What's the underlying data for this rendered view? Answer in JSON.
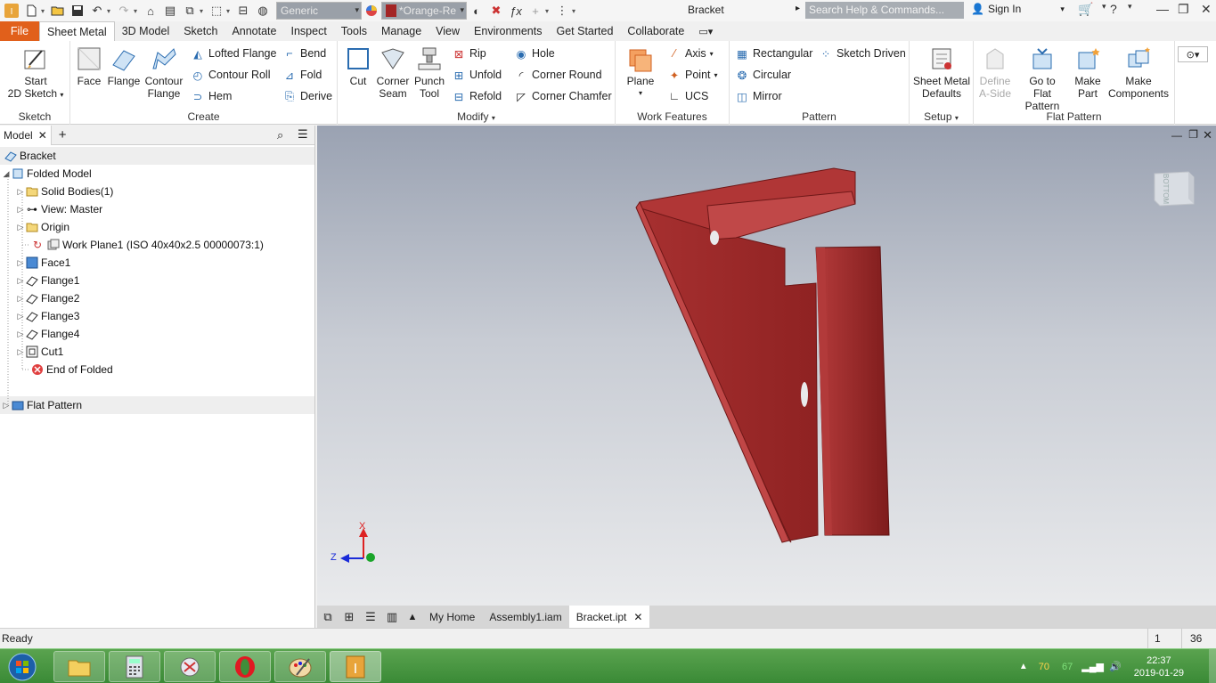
{
  "titlebar": {
    "style_combo": "Generic",
    "appearance_combo": "*Orange-Re",
    "title": "Bracket",
    "search_placeholder": "Search Help & Commands...",
    "signin": "Sign In"
  },
  "tabs": [
    "File",
    "Sheet Metal",
    "3D Model",
    "Sketch",
    "Annotate",
    "Inspect",
    "Tools",
    "Manage",
    "View",
    "Environments",
    "Get Started",
    "Collaborate"
  ],
  "ribbon": {
    "sketch": {
      "title": "Sketch",
      "start_line1": "Start",
      "start_line2": "2D Sketch"
    },
    "create": {
      "title": "Create",
      "face": "Face",
      "flange": "Flange",
      "contour_line1": "Contour",
      "contour_line2": "Flange",
      "lofted": "Lofted Flange",
      "contour_roll": "Contour Roll",
      "hem": "Hem",
      "bend": "Bend",
      "fold": "Fold",
      "derive": "Derive"
    },
    "modify": {
      "title": "Modify",
      "cut": "Cut",
      "corner_line1": "Corner",
      "corner_line2": "Seam",
      "punch_line1": "Punch",
      "punch_line2": "Tool",
      "rip": "Rip",
      "unfold": "Unfold",
      "refold": "Refold",
      "hole": "Hole",
      "corner_round": "Corner Round",
      "corner_chamfer": "Corner Chamfer"
    },
    "work": {
      "title": "Work Features",
      "plane": "Plane",
      "axis": "Axis",
      "point": "Point",
      "ucs": "UCS"
    },
    "pattern": {
      "title": "Pattern",
      "rectangular": "Rectangular",
      "circular": "Circular",
      "mirror": "Mirror",
      "sketch_driven": "Sketch Driven"
    },
    "setup": {
      "title": "Setup",
      "defaults_line1": "Sheet Metal",
      "defaults_line2": "Defaults"
    },
    "flat": {
      "title": "Flat Pattern",
      "define_line1": "Define",
      "define_line2": "A-Side",
      "goto_line1": "Go to",
      "goto_line2": "Flat Pattern",
      "make_part_line1": "Make",
      "make_part_line2": "Part",
      "make_comp_line1": "Make",
      "make_comp_line2": "Components"
    }
  },
  "browser": {
    "tab": "Model",
    "nodes": [
      "Bracket",
      "Folded Model",
      "Solid Bodies(1)",
      "View: Master",
      "Origin",
      "Work Plane1 (ISO 40x40x2.5 00000073:1)",
      "Face1",
      "Flange1",
      "Flange2",
      "Flange3",
      "Flange4",
      "Cut1",
      "End of Folded",
      "Flat Pattern"
    ]
  },
  "viewcube": {
    "face": "BOTTOM"
  },
  "triad": {
    "x": "X",
    "z": "Z"
  },
  "doctabs": [
    "My Home",
    "Assembly1.iam",
    "Bracket.ipt"
  ],
  "status": {
    "text": "Ready",
    "count1": "1",
    "count2": "36"
  },
  "tray": {
    "time": "22:37",
    "date": "2019-01-29",
    "n1": "70",
    "n2": "67"
  },
  "colors": {
    "accent": "#e1601b",
    "part": "#9e2626",
    "taskbar": "#3f8e3a"
  }
}
